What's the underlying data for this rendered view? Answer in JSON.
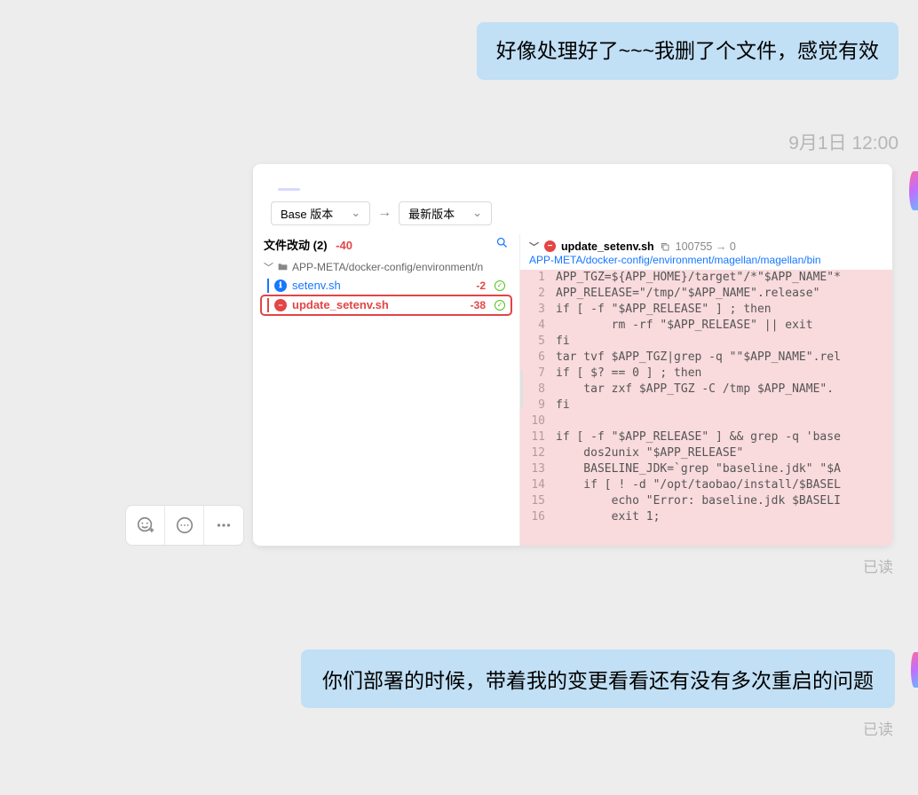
{
  "messages": {
    "first": "好像处理好了~~~我删了个文件，感觉有效",
    "second": "你们部署的时候，带着我的变更看看还有没有多次重启的问题"
  },
  "timestamp": "9月1日 12:00",
  "read_status": "已读",
  "screenshot": {
    "selectors": {
      "base": "Base 版本",
      "latest": "最新版本"
    },
    "changes": {
      "title_prefix": "文件改动 (",
      "count": "2",
      "title_suffix": ")",
      "total_diff": "-40",
      "folder_path": "APP-META/docker-config/environment/n"
    },
    "files": [
      {
        "name": "setenv.sh",
        "diff": "-2",
        "status": "modified",
        "icon": "ℹ"
      },
      {
        "name": "update_setenv.sh",
        "diff": "-38",
        "status": "deleted",
        "icon": "−"
      }
    ],
    "right": {
      "filename": "update_setenv.sh",
      "permissions": "100755 → 0",
      "path": "APP-META/docker-config/environment/magellan/magellan/bin",
      "code": [
        "APP_TGZ=${APP_HOME}/target\"/*\"$APP_NAME\"*",
        "APP_RELEASE=\"/tmp/\"$APP_NAME\".release\"",
        "if [ -f \"$APP_RELEASE\" ] ; then",
        "        rm -rf \"$APP_RELEASE\" || exit",
        "fi",
        "tar tvf $APP_TGZ|grep -q \"\"$APP_NAME\".rel",
        "if [ $? == 0 ] ; then",
        "    tar zxf $APP_TGZ -C /tmp $APP_NAME\".",
        "fi",
        "",
        "if [ -f \"$APP_RELEASE\" ] && grep -q 'base",
        "    dos2unix \"$APP_RELEASE\"",
        "    BASELINE_JDK=`grep \"baseline.jdk\" \"$A",
        "    if [ ! -d \"/opt/taobao/install/$BASEL",
        "        echo \"Error: baseline.jdk $BASELI",
        "        exit 1;"
      ]
    }
  }
}
